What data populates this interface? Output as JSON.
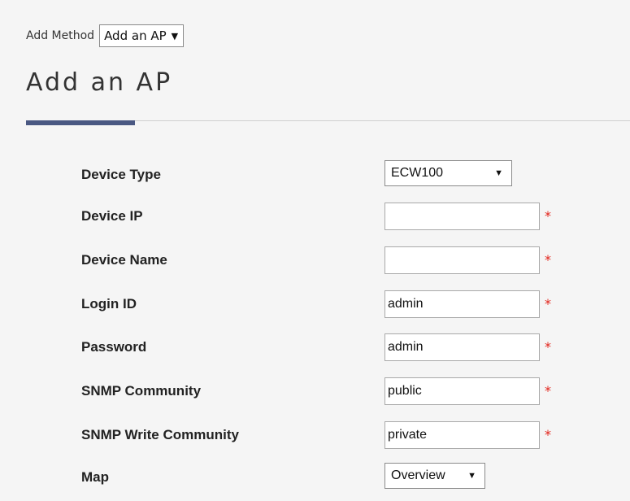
{
  "top": {
    "add_method_label": "Add Method",
    "add_method_value": "Add an AP"
  },
  "page": {
    "title": "Add an AP"
  },
  "form": {
    "device_type": {
      "label": "Device Type",
      "value": "ECW100"
    },
    "device_ip": {
      "label": "Device IP",
      "value": "",
      "required": "*"
    },
    "device_name": {
      "label": "Device Name",
      "value": "",
      "required": "*"
    },
    "login_id": {
      "label": "Login ID",
      "value": "admin",
      "required": "*"
    },
    "password": {
      "label": "Password",
      "value": "admin",
      "required": "*"
    },
    "snmp_community": {
      "label": "SNMP Community",
      "value": "public",
      "required": "*"
    },
    "snmp_write_community": {
      "label": "SNMP Write Community",
      "value": "private",
      "required": "*"
    },
    "map": {
      "label": "Map",
      "value": "Overview"
    }
  },
  "icons": {
    "dropdown_arrow": "▼"
  },
  "colors": {
    "accent": "#4a5882",
    "required": "#e2231a",
    "background": "#f5f5f5"
  }
}
